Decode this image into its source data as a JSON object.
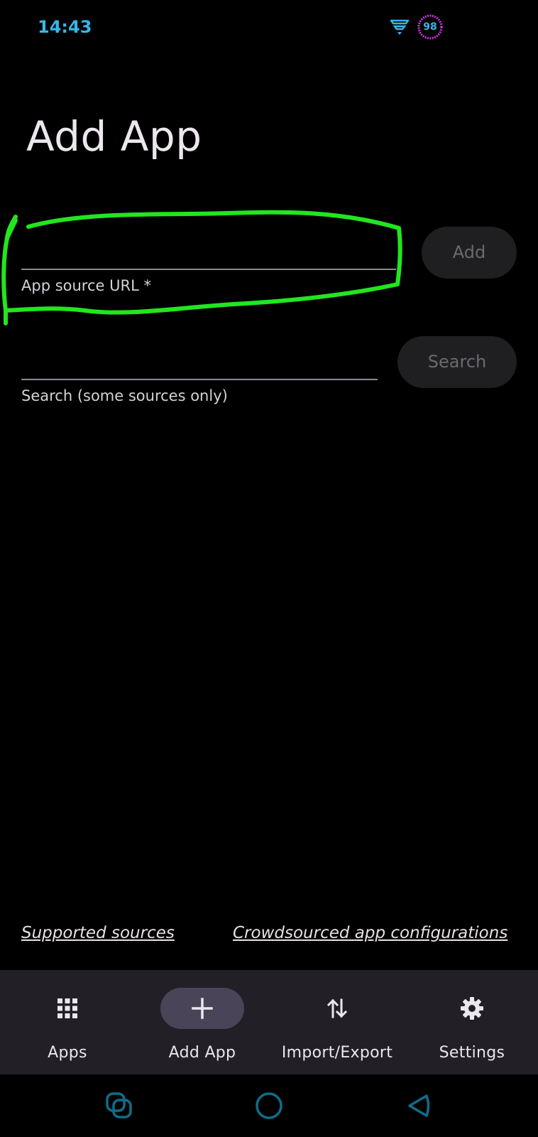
{
  "status_bar": {
    "time": "14:43",
    "battery_level": "98",
    "icons": [
      "wifi-icon",
      "battery-ring-icon"
    ],
    "accent_color": "#38b6e8",
    "battery_ring_color": "#d633e0"
  },
  "page": {
    "title": "Add App"
  },
  "url_field": {
    "value": "",
    "label": "App source URL *"
  },
  "add_button": {
    "label": "Add"
  },
  "search_field": {
    "value": "",
    "label": "Search (some sources only)"
  },
  "search_button": {
    "label": "Search"
  },
  "annotation": {
    "color": "#22e61e",
    "shape": "hand-drawn circle around URL field"
  },
  "links": {
    "supported_sources": "Supported sources",
    "crowdsourced": "Crowdsourced app configurations"
  },
  "bottom_nav": {
    "items": [
      {
        "label": "Apps",
        "icon": "grid-icon",
        "active": false
      },
      {
        "label": "Add App",
        "icon": "plus-icon",
        "active": true
      },
      {
        "label": "Import/Export",
        "icon": "import-export-icon",
        "active": false
      },
      {
        "label": "Settings",
        "icon": "gear-icon",
        "active": false
      }
    ],
    "background": "#221f26",
    "active_indicator": "#4a4458"
  },
  "system_nav": {
    "icons": [
      "recents-icon",
      "home-icon",
      "back-icon"
    ],
    "color": "#0e6d8a"
  }
}
